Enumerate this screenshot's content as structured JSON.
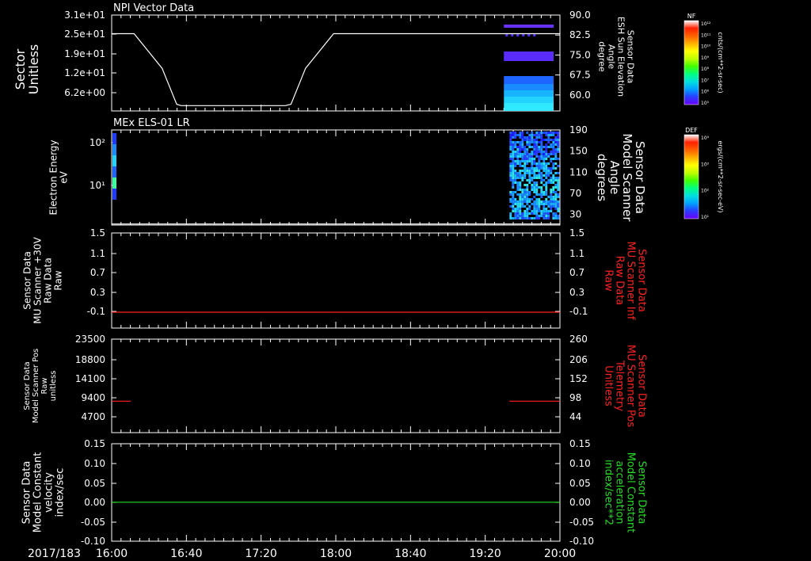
{
  "date_label": "2017/183",
  "time_ticks": [
    "16:00",
    "16:40",
    "17:20",
    "18:00",
    "18:40",
    "19:20",
    "20:00"
  ],
  "colors": {
    "white": "#ffffff",
    "red": "#ff2020",
    "green": "#22dd22",
    "background": "#000000"
  },
  "chart_data": [
    {
      "type": "spectrogram",
      "title": "NPI Vector Data",
      "ylabel_left": [
        "Sector",
        "Unitless"
      ],
      "ylabel_right": [
        "Sensor Data",
        "ESH Sun Elevation",
        "Angle",
        "degree"
      ],
      "left_ticks": [
        "3.1e+01",
        "2.5e+01",
        "1.9e+01",
        "1.2e+01",
        "6.2e+00"
      ],
      "right_ticks": [
        "90.0",
        "82.5",
        "75.0",
        "67.5",
        "60.0"
      ],
      "right_ylim": [
        54,
        90
      ],
      "colorbar": {
        "title": "NF",
        "units": "cnts/(cm**2-sr-sec)",
        "ticks": [
          "10¹²",
          "10¹¹",
          "10¹⁰",
          "10⁹",
          "10⁸",
          "10⁷",
          "10⁶",
          "10⁵"
        ]
      },
      "line_series": {
        "name": "ESH Sun Elevation Angle",
        "x_hours": [
          16.0,
          16.2,
          16.45,
          16.58,
          16.62,
          17.55,
          17.6,
          17.73,
          17.98,
          18.03,
          20.0
        ],
        "y": [
          83.0,
          83.0,
          70.0,
          56.5,
          56.0,
          56.0,
          56.5,
          70.0,
          83.0,
          83.0,
          83.0
        ]
      },
      "spectrogram_window_hours": [
        19.5,
        20.0
      ]
    },
    {
      "type": "spectrogram",
      "title": "MEx ELS-01 LR",
      "ylabel_left": [
        "Electron Energy",
        "eV"
      ],
      "ylabel_right": [
        "Sensor Data",
        "Model Scanner",
        "Angle",
        "degrees"
      ],
      "left_ticks": [
        "10²",
        "10¹"
      ],
      "right_ticks": [
        "190",
        "150",
        "110",
        "70",
        "30"
      ],
      "right_ylim": [
        10,
        190
      ],
      "colorbar": {
        "title": "DEF",
        "units": "ergs/(cm**2-sr-sec-eV)",
        "ticks": [
          "10⁴",
          "10³",
          "10²",
          "10¹"
        ]
      },
      "line_series": {
        "name": "Model Scanner Angle",
        "x_hours": [
          16.0,
          20.0
        ],
        "y": [
          12,
          12
        ]
      },
      "spectrogram_window_hours": [
        19.55,
        20.0
      ]
    },
    {
      "type": "line",
      "ylabel_left": [
        "Sensor Data",
        "MU Scanner +30V",
        "Raw Data",
        "Raw"
      ],
      "ylabel_right": [
        "Sensor Data",
        "MU Scanner Inf",
        "Raw Data",
        "Raw"
      ],
      "left_ticks": [
        "1.5",
        "1.1",
        "0.7",
        "0.3",
        "-0.1"
      ],
      "right_ticks": [
        "1.5",
        "1.1",
        "0.7",
        "0.3",
        "-0.1"
      ],
      "ylim": [
        -0.3,
        1.5
      ],
      "series": [
        {
          "color": "#ff2020",
          "x_hours": [
            16.0,
            20.0
          ],
          "y": [
            0.0,
            0.0
          ]
        }
      ]
    },
    {
      "type": "line",
      "ylabel_left": [
        "Sensor Data",
        "Model Scanner Pos",
        "Raw",
        "unitless"
      ],
      "ylabel_right": [
        "Sensor Data",
        "MU Scanner Pos",
        "Telemetry",
        "Unitless"
      ],
      "left_ticks": [
        "23500",
        "18800",
        "14100",
        "9400",
        "4700"
      ],
      "right_ticks": [
        "260",
        "206",
        "152",
        "98",
        "44"
      ],
      "ylim": [
        0,
        23500
      ],
      "series": [
        {
          "color": "#ff2020",
          "x_hours": [
            16.0,
            16.17
          ],
          "y": [
            7900,
            7900
          ]
        },
        {
          "color": "#ff2020",
          "x_hours": [
            19.55,
            20.0
          ],
          "y": [
            7900,
            7900
          ]
        }
      ]
    },
    {
      "type": "line",
      "ylabel_left": [
        "Sensor Data",
        "Model Constant",
        "velocity",
        "index/sec"
      ],
      "ylabel_right": [
        "Sensor Data",
        "Model Constant",
        "acceleration",
        "index/sec**2"
      ],
      "left_ticks": [
        "0.15",
        "0.10",
        "0.05",
        "0.00",
        "-0.05",
        "-0.10"
      ],
      "right_ticks": [
        "0.15",
        "0.10",
        "0.05",
        "0.00",
        "-0.05",
        "-0.10"
      ],
      "ylim": [
        -0.1,
        0.15
      ],
      "series": [
        {
          "color": "#22dd22",
          "x_hours": [
            16.0,
            20.0
          ],
          "y": [
            0.0,
            0.0
          ]
        }
      ]
    }
  ]
}
